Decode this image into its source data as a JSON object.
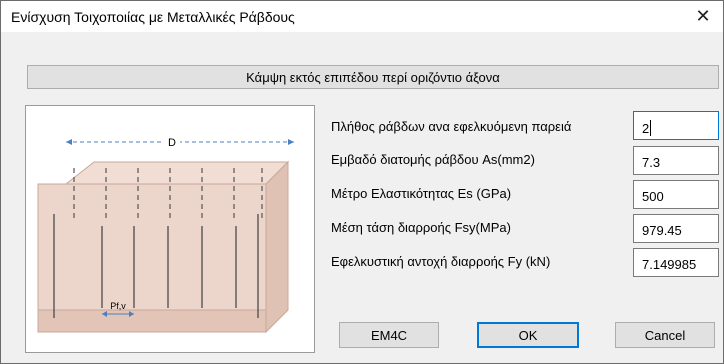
{
  "window": {
    "title": "Ενίσχυση Τοιχοποιίας με Μεταλλικές Ράβδους",
    "close_glyph": "✕"
  },
  "section_title": "Κάμψη εκτός επιπέδου περί οριζόντιο άξονα",
  "figure": {
    "dimension_label_top": "D",
    "dimension_label_bottom": "Pf,v",
    "fill_color": "#e8d1c5",
    "edge_color": "#c9a898"
  },
  "fields": [
    {
      "label": "Πλήθος ράβδων ανα εφελκυόμενη παρειά",
      "value": "2"
    },
    {
      "label": "Εμβαδό διατομής ράβδου As(mm2)",
      "value": "7.3"
    },
    {
      "label": "Μέτρο Ελαστικότητας Es (GPa)",
      "value": "500"
    },
    {
      "label": "Μέση τάση διαρροής Fsy(MPa)",
      "value": "979.45"
    },
    {
      "label": "Εφελκυστική αντοχή διαρροής Fy (kN)",
      "value": "7.149985"
    }
  ],
  "buttons": {
    "em4c": "EM4C",
    "ok": "OK",
    "cancel": "Cancel"
  },
  "accent_color": "#0078d7"
}
